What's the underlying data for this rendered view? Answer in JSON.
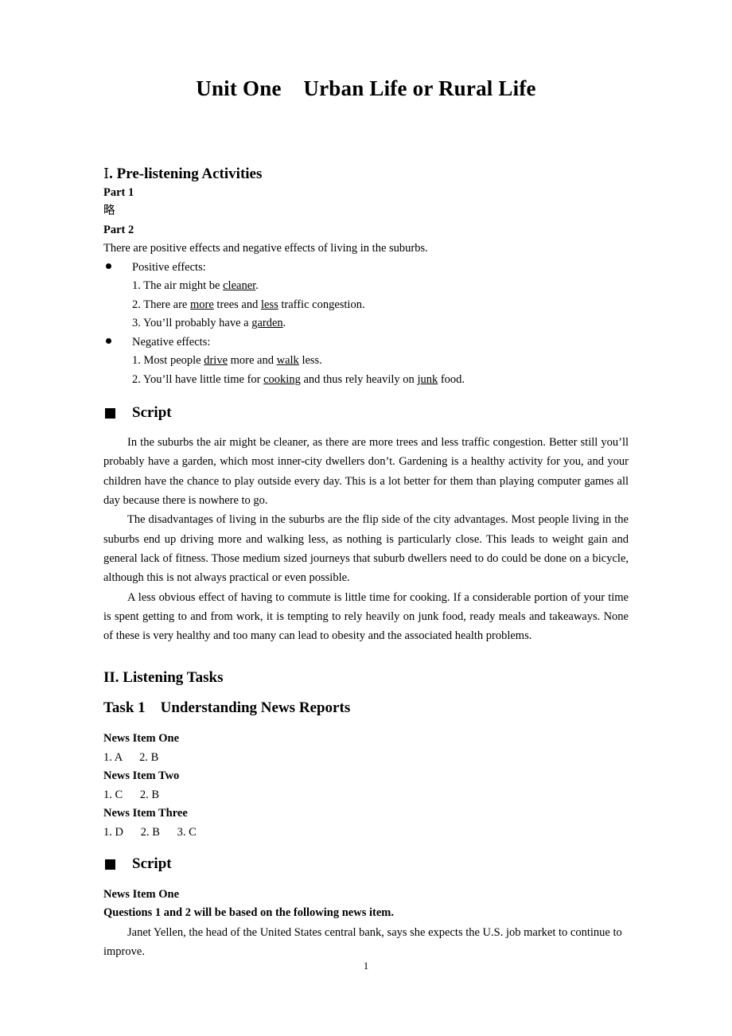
{
  "document": {
    "title": "Unit One    Urban Life or Rural Life",
    "page_number": "1"
  },
  "section_one": {
    "heading_roman": "Ⅰ",
    "heading_text": ". Pre-listening Activities",
    "part1_label": "Part 1",
    "part1_answer": "略",
    "part2_label": "Part 2",
    "part2_intro": "There are positive effects and negative effects of living in the suburbs.",
    "positive_label": "Positive effects:",
    "positive_items": [
      {
        "prefix": "1. The air might be ",
        "answer": "cleaner",
        "suffix": "."
      },
      {
        "prefix": "2. There are ",
        "answer": "more",
        "middle": " trees and ",
        "answer2": "less",
        "suffix": " traffic congestion."
      },
      {
        "prefix": "3. You’ll probably have a ",
        "answer": "garden",
        "suffix": "."
      }
    ],
    "negative_label": "Negative effects:",
    "negative_items": [
      {
        "prefix": "1. Most people ",
        "answer": "drive",
        "middle": " more and ",
        "answer2": "walk",
        "suffix": " less."
      },
      {
        "prefix": "2. You’ll have little time for ",
        "answer": "cooking",
        "middle": " and thus rely heavily on ",
        "answer2": "junk",
        "suffix": " food."
      }
    ],
    "script_heading": "Script",
    "script_paragraphs": [
      "In the suburbs the air might be cleaner, as there are more trees and less traffic congestion. Better still you’ll probably have a garden, which most inner-city dwellers don’t. Gardening is a healthy activity for you, and your children have the chance to play outside every day. This is a lot better for them than playing computer games all day because there is nowhere to go.",
      "The disadvantages of living in the suburbs are the flip side of the city advantages. Most people living in the suburbs end up driving more and walking less, as nothing is particularly close. This leads to weight gain and general lack of fitness. Those medium sized journeys that suburb dwellers need to do could be done on a bicycle, although this is not always practical or even possible.",
      "A less obvious effect of having to commute is little time for cooking. If a considerable portion of your time is spent getting to and from work, it is tempting to rely heavily on junk food, ready meals and takeaways. None of these is very healthy and too many can lead to obesity and the associated health problems."
    ]
  },
  "section_two": {
    "heading": "II. Listening Tasks",
    "task_heading": "Task 1    Understanding News Reports",
    "news_answers": [
      {
        "label": "News Item One",
        "answers": "1. A      2. B"
      },
      {
        "label": "News Item Two",
        "answers": "1. C      2. B"
      },
      {
        "label": "News Item Three",
        "answers": "1. D      2. B      3. C"
      }
    ],
    "script_heading": "Script",
    "script_item_label": "News Item One",
    "script_question_line": "Questions 1 and 2 will be based on the following news item.",
    "script_body": "Janet Yellen, the head of the United States central bank, says she expects the U.S. job market to continue to improve."
  }
}
